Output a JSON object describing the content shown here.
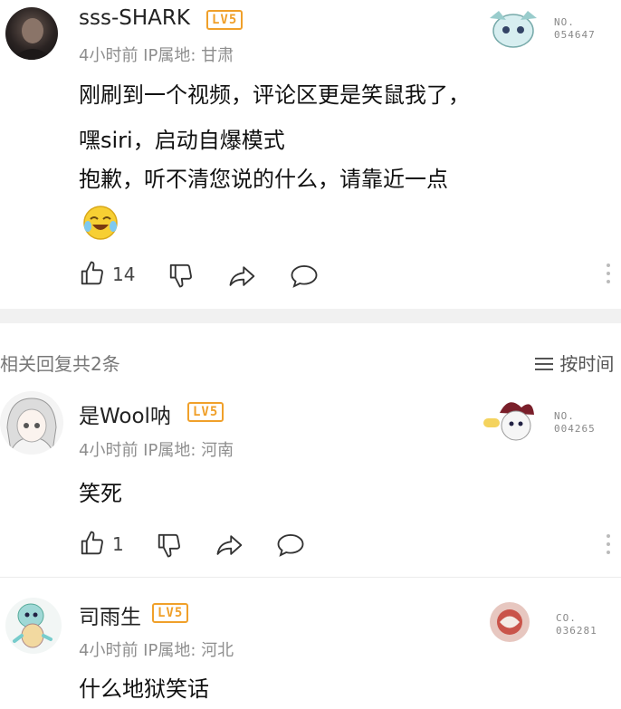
{
  "main_comment": {
    "username": "sss-SHARK",
    "level": "LV5",
    "meta": "4小时前  IP属地: 甘肃",
    "badge_no_label": "NO.",
    "badge_no_value": "054647",
    "lines": [
      "刚刷到一个视频，评论区更是笑鼠我了，",
      "嘿siri，启动自爆模式",
      "抱歉，听不清您说的什么，请靠近一点"
    ],
    "emoji": "laughing-cry-emoji",
    "like_count": "14"
  },
  "replies_header": {
    "title": "相关回复共2条",
    "sort_label": "按时间"
  },
  "replies": [
    {
      "username": "是Wool呐",
      "level": "LV5",
      "meta": "4小时前  IP属地: 河南",
      "badge_no_label": "NO.",
      "badge_no_value": "004265",
      "text": "笑死",
      "like_count": "1"
    },
    {
      "username": "司雨生",
      "level": "LV5",
      "meta": "4小时前  IP属地: 河北",
      "badge_no_label": "CO.",
      "badge_no_value": "036281",
      "text": "什么地狱笑话"
    }
  ],
  "colors": {
    "level_badge": "#f0a02a",
    "meta_gray": "#8e8e8e",
    "divider": "#f1f1f1"
  }
}
